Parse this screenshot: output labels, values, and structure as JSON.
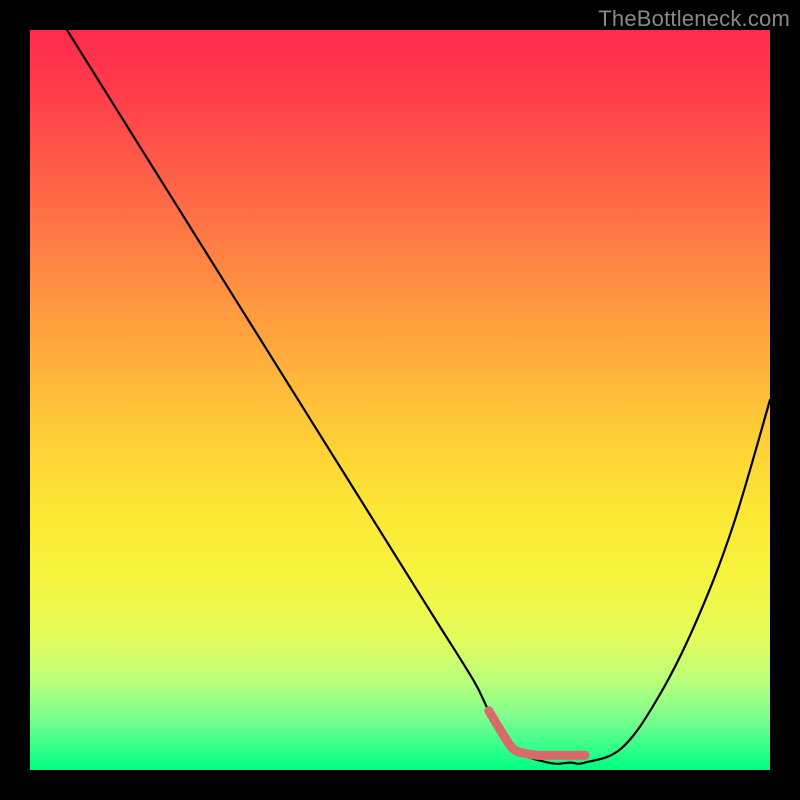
{
  "watermark": "TheBottleneck.com",
  "chart_data": {
    "type": "line",
    "title": "",
    "xlabel": "",
    "ylabel": "",
    "xlim": [
      0,
      100
    ],
    "ylim": [
      0,
      100
    ],
    "grid": false,
    "series": [
      {
        "name": "curve",
        "x": [
          5,
          10,
          15,
          20,
          25,
          30,
          35,
          40,
          45,
          50,
          55,
          60,
          62,
          65,
          70,
          73,
          75,
          80,
          85,
          90,
          95,
          100
        ],
        "y": [
          100,
          92,
          84,
          76,
          68,
          60,
          52,
          44,
          36,
          28,
          20,
          12,
          8,
          3,
          1,
          1,
          1,
          3,
          10,
          20,
          33,
          50
        ]
      }
    ],
    "annotations": [
      {
        "type": "highlight",
        "label": "optimal-range",
        "x_range": [
          62,
          75
        ],
        "y": 2
      }
    ],
    "background": {
      "type": "vertical-gradient",
      "stops": [
        {
          "pos": 0.0,
          "color": "#ff2a4f"
        },
        {
          "pos": 0.5,
          "color": "#ffd635"
        },
        {
          "pos": 0.8,
          "color": "#f6f43f"
        },
        {
          "pos": 1.0,
          "color": "#00ff82"
        }
      ]
    }
  }
}
